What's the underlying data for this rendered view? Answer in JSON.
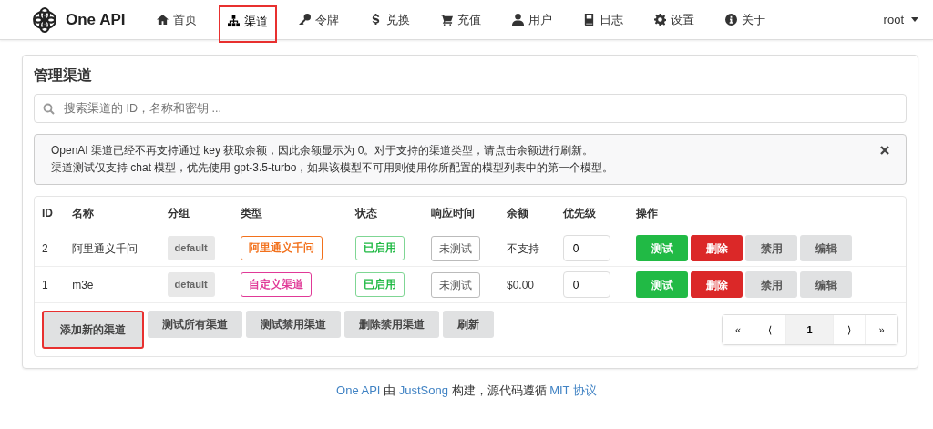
{
  "brand": "One API",
  "nav": [
    {
      "label": "首页",
      "selected": false,
      "highlighted": false
    },
    {
      "label": "渠道",
      "selected": true,
      "highlighted": true
    },
    {
      "label": "令牌",
      "selected": false,
      "highlighted": false
    },
    {
      "label": "兑换",
      "selected": false,
      "highlighted": false
    },
    {
      "label": "充值",
      "selected": false,
      "highlighted": false
    },
    {
      "label": "用户",
      "selected": false,
      "highlighted": false
    },
    {
      "label": "日志",
      "selected": false,
      "highlighted": false
    },
    {
      "label": "设置",
      "selected": false,
      "highlighted": false
    },
    {
      "label": "关于",
      "selected": false,
      "highlighted": false
    }
  ],
  "user": "root",
  "page_title": "管理渠道",
  "search": {
    "placeholder": "搜索渠道的 ID，名称和密钥 ..."
  },
  "notice": [
    "OpenAI 渠道已经不再支持通过 key 获取余额，因此余额显示为 0。对于支持的渠道类型，请点击余额进行刷新。",
    "渠道测试仅支持 chat 模型，优先使用 gpt-3.5-turbo，如果该模型不可用则使用你所配置的模型列表中的第一个模型。"
  ],
  "table": {
    "columns": [
      "ID",
      "名称",
      "分组",
      "类型",
      "状态",
      "响应时间",
      "余额",
      "优先级",
      "操作"
    ],
    "rows": [
      {
        "id": "2",
        "name": "阿里通义千问",
        "group": "default",
        "type": "阿里通义千问",
        "color": "#f2711c",
        "status": "已启用",
        "response": "未测试",
        "balance": "不支持",
        "priority": "0",
        "actions": [
          "测试",
          "删除",
          "禁用",
          "编辑"
        ]
      },
      {
        "id": "1",
        "name": "m3e",
        "group": "default",
        "type": "自定义渠道",
        "color": "#e03997",
        "status": "已启用",
        "response": "未测试",
        "balance": "$0.00",
        "priority": "0",
        "actions": [
          "测试",
          "删除",
          "禁用",
          "编辑"
        ]
      }
    ]
  },
  "footer_buttons": [
    {
      "label": "添加新的渠道",
      "highlighted": true
    },
    {
      "label": "测试所有渠道",
      "highlighted": false
    },
    {
      "label": "测试禁用渠道",
      "highlighted": false
    },
    {
      "label": "删除禁用渠道",
      "highlighted": false
    },
    {
      "label": "刷新",
      "highlighted": false
    }
  ],
  "pagination": [
    {
      "label": "«",
      "selected": false
    },
    {
      "label": "⟨",
      "selected": false
    },
    {
      "label": "1",
      "selected": true
    },
    {
      "label": "⟩",
      "selected": false
    },
    {
      "label": "»",
      "selected": false
    }
  ],
  "footer": [
    {
      "text": "One API",
      "link": true
    },
    {
      "text": " 由 ",
      "link": false
    },
    {
      "text": "JustSong",
      "link": true
    },
    {
      "text": " 构建，源代码遵循 ",
      "link": false
    },
    {
      "text": "MIT 协议",
      "link": true
    }
  ]
}
